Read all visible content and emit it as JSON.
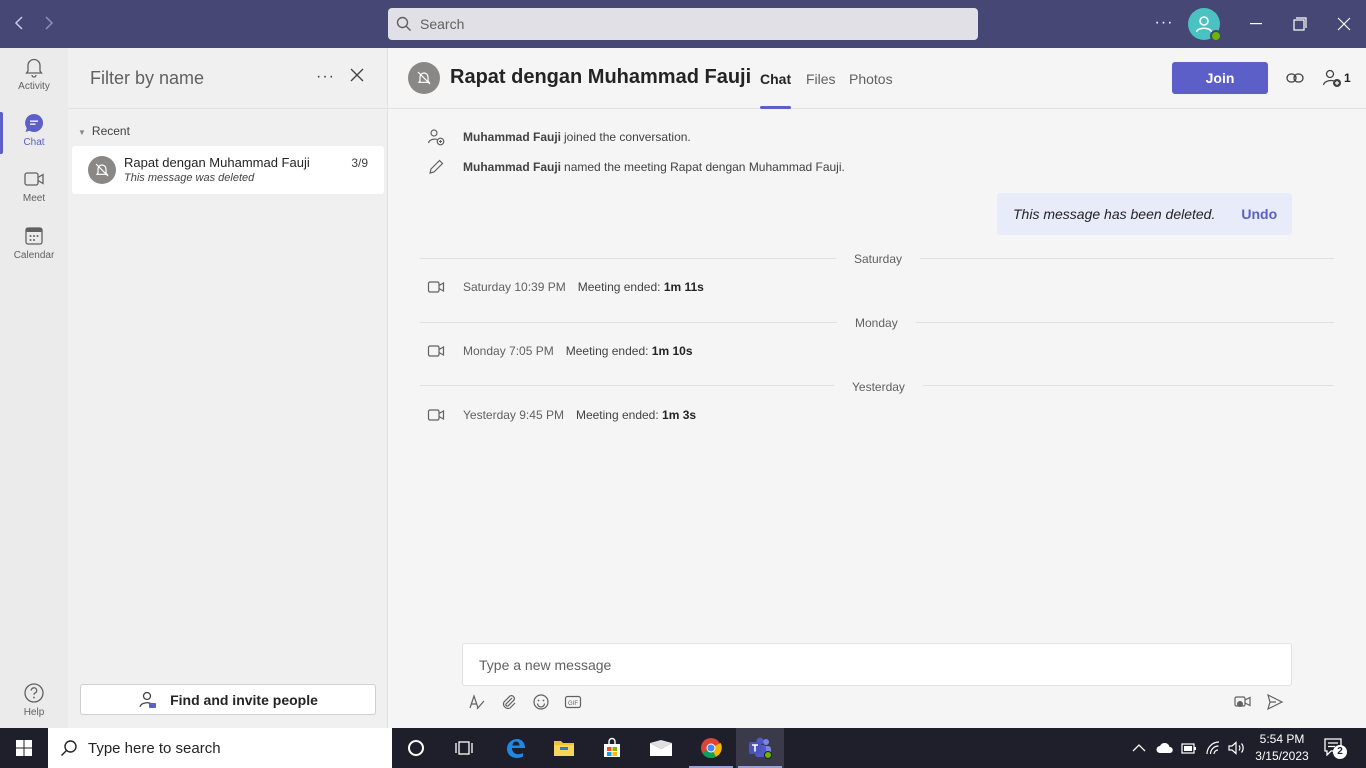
{
  "topbar": {
    "search_placeholder": "Search",
    "more_label": "···"
  },
  "rail": {
    "items": [
      {
        "label": "Activity"
      },
      {
        "label": "Chat"
      },
      {
        "label": "Meet"
      },
      {
        "label": "Calendar"
      },
      {
        "label": "Help"
      }
    ]
  },
  "chatlist": {
    "filter_placeholder": "Filter by name",
    "more_label": "···",
    "section_label": "Recent",
    "chats": [
      {
        "name": "Rapat dengan Muhammad Fauji",
        "date": "3/9",
        "preview": "This message was deleted"
      }
    ],
    "invite_label": "Find and invite people"
  },
  "conversation": {
    "title": "Rapat dengan Muhammad Fauji",
    "tabs": [
      "Chat",
      "Files",
      "Photos"
    ],
    "join_label": "Join",
    "participant_count": "1",
    "system_messages": [
      {
        "name": "Muhammad Fauji",
        "text": "joined the conversation."
      },
      {
        "name": "Muhammad Fauji",
        "text": "named the meeting Rapat dengan Muhammad Fauji."
      }
    ],
    "deleted_notice": {
      "text": "This message has been deleted.",
      "undo_label": "Undo"
    },
    "meetings": [
      {
        "divider": "Saturday",
        "time": "Saturday 10:39 PM",
        "ended_label": "Meeting ended:",
        "duration": "1m 11s"
      },
      {
        "divider": "Monday",
        "time": "Monday 7:05 PM",
        "ended_label": "Meeting ended:",
        "duration": "1m 10s"
      },
      {
        "divider": "Yesterday",
        "time": "Yesterday 9:45 PM",
        "ended_label": "Meeting ended:",
        "duration": "1m 3s"
      }
    ],
    "composer_placeholder": "Type a new message"
  },
  "taskbar": {
    "search_placeholder": "Type here to search",
    "time": "5:54 PM",
    "date": "3/15/2023",
    "notification_count": "2"
  },
  "colors": {
    "topbar": "#464775",
    "accent": "#5b5fc7",
    "presence": "#6bb700"
  }
}
